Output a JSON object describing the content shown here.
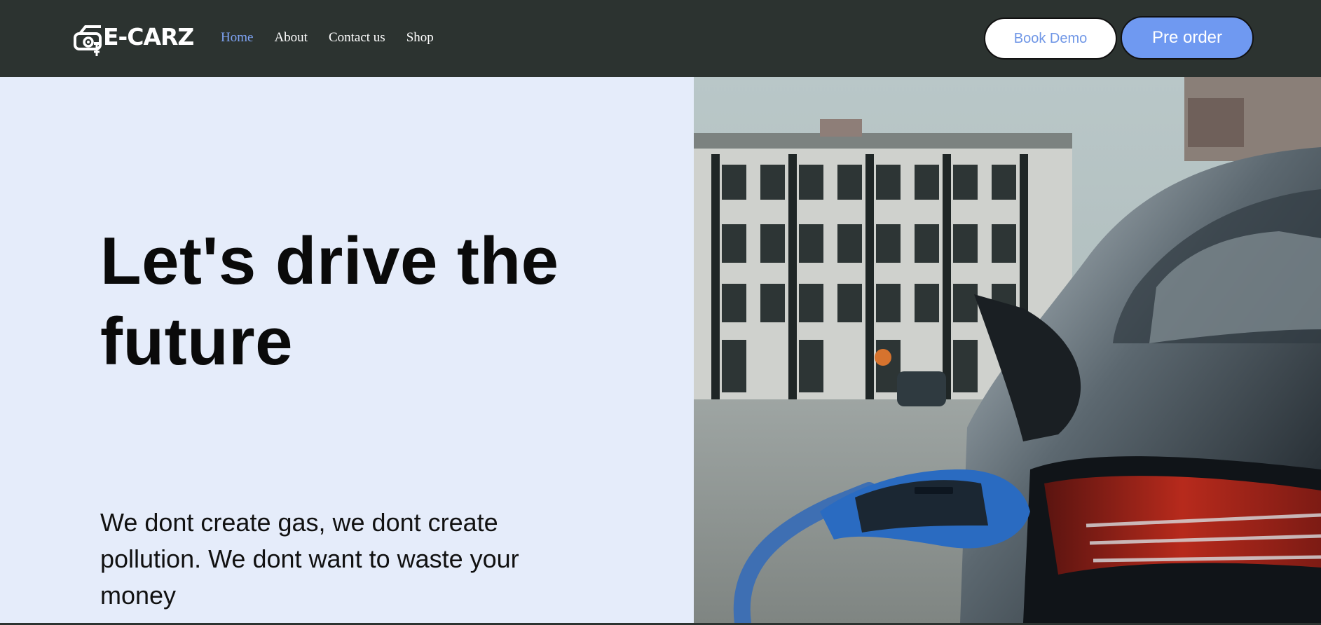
{
  "brand": {
    "name": "E-CARZ",
    "logo_icon": "car-plug-icon"
  },
  "nav": {
    "items": [
      {
        "label": "Home",
        "active": true
      },
      {
        "label": "About",
        "active": false
      },
      {
        "label": "Contact us",
        "active": false
      },
      {
        "label": "Shop",
        "active": false
      }
    ]
  },
  "actions": {
    "book_demo": "Book Demo",
    "pre_order": "Pre order"
  },
  "hero": {
    "title": "Let's drive the future",
    "text": "We dont create gas, we dont create pollution. We dont want to waste your money",
    "image_icon": "ev-charging-photo"
  },
  "colors": {
    "navbar": "#2c3330",
    "accent": "#6f99f1",
    "active_link": "#7ea3f3",
    "hero_background": "#e5ecfa"
  }
}
